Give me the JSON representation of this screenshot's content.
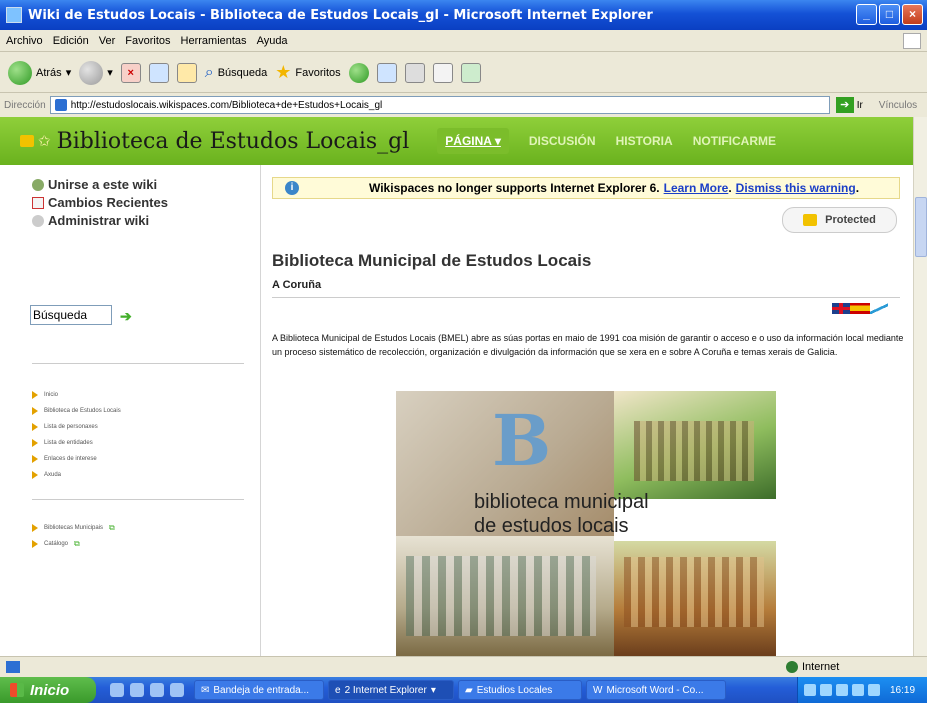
{
  "window": {
    "title": "Wiki de Estudos Locais - Biblioteca de Estudos Locais_gl - Microsoft Internet Explorer"
  },
  "menu": [
    "Archivo",
    "Edición",
    "Ver",
    "Favoritos",
    "Herramientas",
    "Ayuda"
  ],
  "toolbar": {
    "back_label": "Atrás",
    "search_label": "Búsqueda",
    "favorites_label": "Favoritos"
  },
  "address": {
    "label": "Dirección",
    "url": "http://estudoslocais.wikispaces.com/Biblioteca+de+Estudos+Locais_gl",
    "go_label": "Ir",
    "links_label": "Vínculos"
  },
  "site": {
    "title": "Biblioteca de Estudos Locais_gl",
    "nav": [
      "PÁGINA ▾",
      "DISCUSIÓN",
      "HISTORIA",
      "NOTIFICARME"
    ]
  },
  "sidebar": {
    "links": [
      "Unirse a este wiki",
      "Cambios Recientes",
      "Administrar wiki"
    ],
    "search_value": "Búsqueda",
    "nav_items": [
      "Inicio",
      "Biblioteca de Estudos Locais",
      "Lista de personaxes",
      "Lista de entidades",
      "Enlaces de interese",
      "Axuda"
    ],
    "external_items": [
      "Bibliotecas Municipais",
      "Catálogo"
    ]
  },
  "main": {
    "warning_text": "Wikispaces no longer supports Internet Explorer 6.",
    "learn_more": "Learn More",
    "dismiss": "Dismiss this warning",
    "protected_label": "Protected",
    "page_title": "Biblioteca Municipal de Estudos Locais",
    "subtitle": "A Coruña",
    "body": "A Biblioteca Municipal de Estudos Locais (BMEL) abre as súas portas en maio de 1991 coa misión de garantir o acceso e o uso da información local mediante un proceso sistemático de recolección, organización e divulgación da información que se xera en e sobre A Coruña e temas xerais de Galicia.",
    "photo_caption_line1": "biblioteca municipal",
    "photo_caption_line2": "de estudos locais"
  },
  "status": {
    "zone": "Internet"
  },
  "taskbar": {
    "start_label": "Inicio",
    "tasks": [
      "Bandeja de entrada...",
      "2 Internet Explorer",
      "Estudios Locales",
      "Microsoft Word - Co..."
    ],
    "clock": "16:19"
  }
}
